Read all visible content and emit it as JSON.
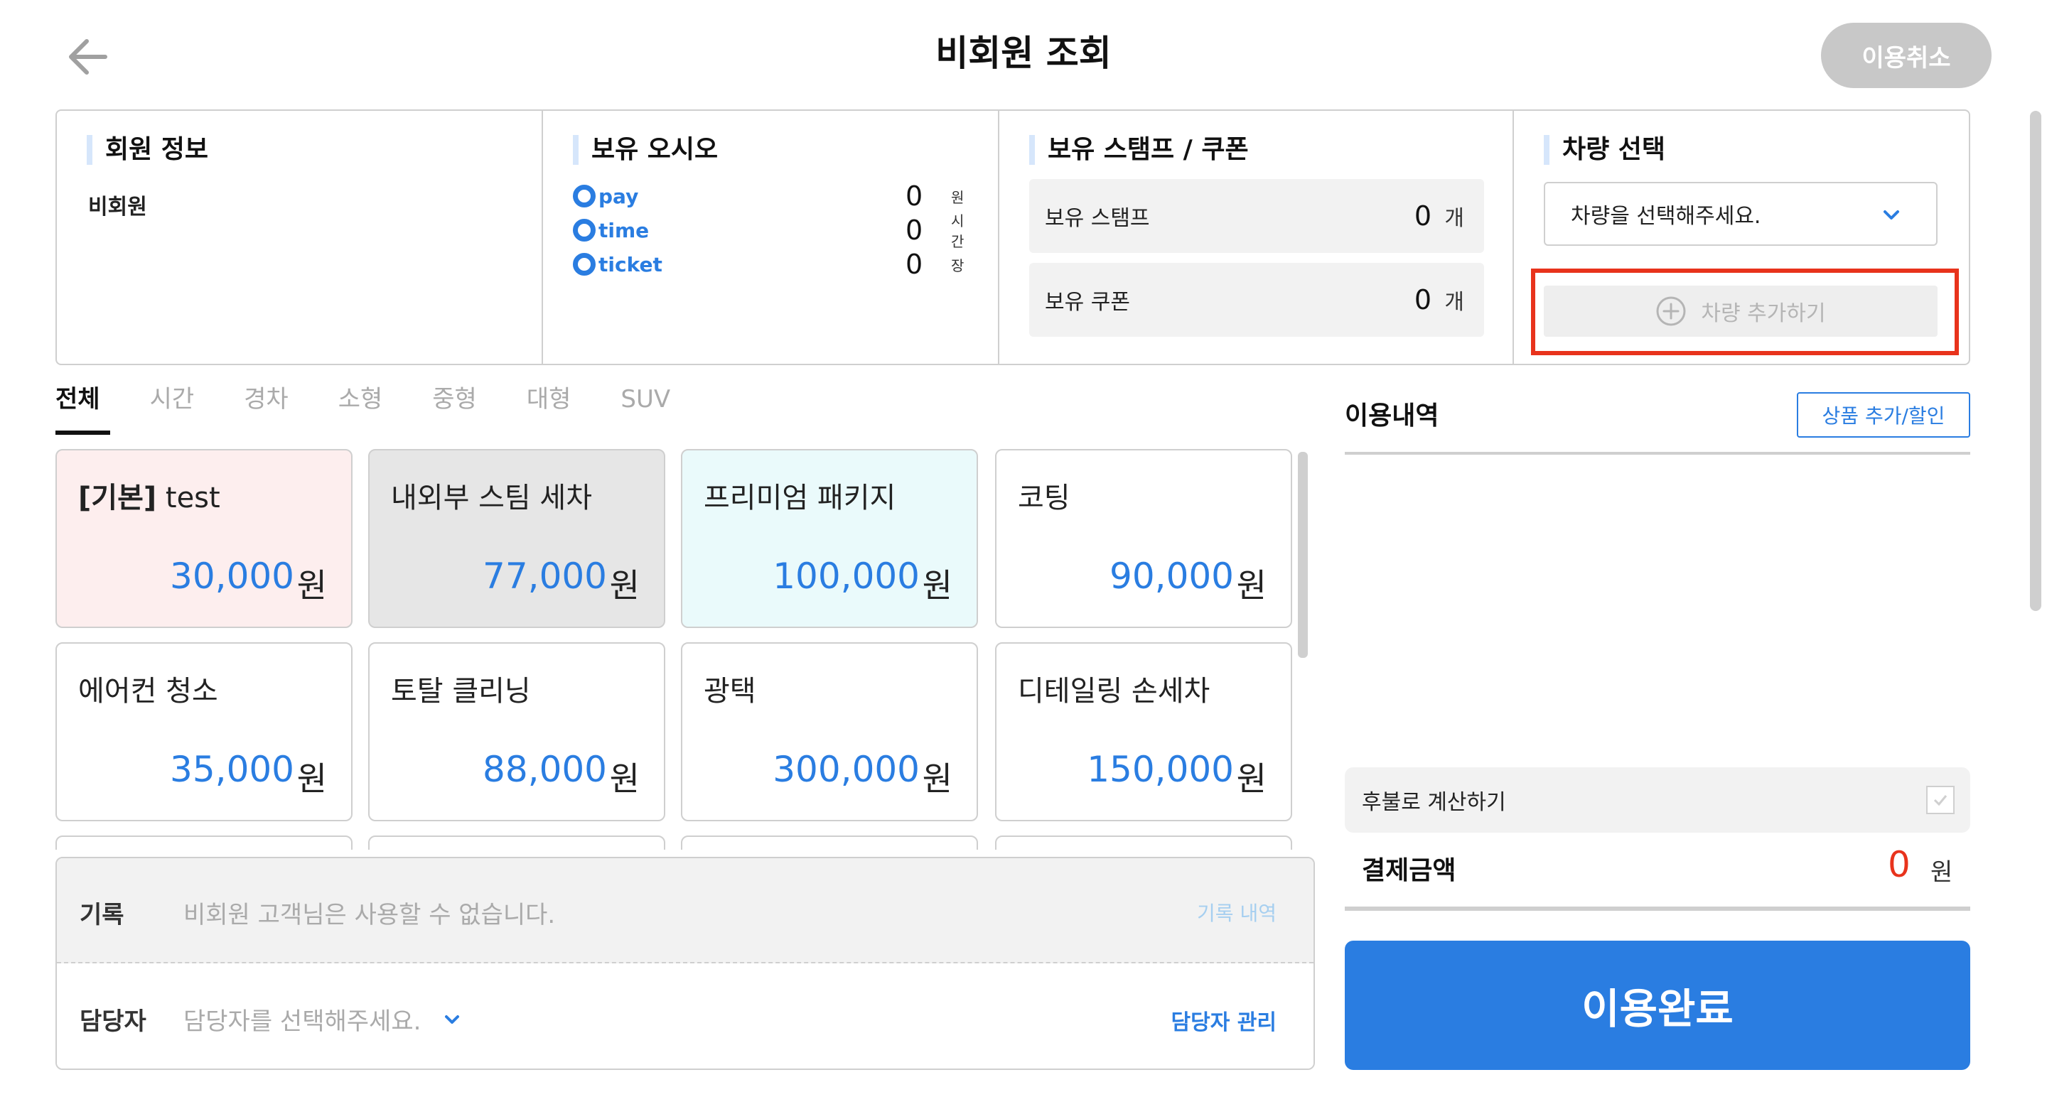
{
  "header": {
    "title": "비회원 조회",
    "cancel_label": "이용취소"
  },
  "member_info": {
    "title": "회원 정보",
    "type": "비회원"
  },
  "oasis": {
    "title": "보유 오시오",
    "items": [
      {
        "name": "pay",
        "value": "0",
        "unit": "원"
      },
      {
        "name": "time",
        "value": "0",
        "unit": "시간"
      },
      {
        "name": "ticket",
        "value": "0",
        "unit": "장"
      }
    ]
  },
  "stamp_coupon": {
    "title": "보유 스탬프 / 쿠폰",
    "stamp_label": "보유 스탬프",
    "stamp_value": "0",
    "stamp_unit": "개",
    "coupon_label": "보유 쿠폰",
    "coupon_value": "0",
    "coupon_unit": "개"
  },
  "car": {
    "title": "차량 선택",
    "select_placeholder": "차량을 선택해주세요.",
    "add_label": "차량 추가하기"
  },
  "tabs": [
    "전체",
    "시간",
    "경차",
    "소형",
    "중형",
    "대형",
    "SUV"
  ],
  "active_tab": "전체",
  "products": [
    {
      "prefix": "[기본]",
      "name": "test",
      "price": "30,000",
      "unit": "원",
      "bg": "#fdeeee"
    },
    {
      "prefix": "",
      "name": "내외부 스팀 세차",
      "price": "77,000",
      "unit": "원",
      "bg": "#e6e6e6"
    },
    {
      "prefix": "",
      "name": "프리미엄 패키지",
      "price": "100,000",
      "unit": "원",
      "bg": "#eafafb"
    },
    {
      "prefix": "",
      "name": "코팅",
      "price": "90,000",
      "unit": "원",
      "bg": "#ffffff"
    },
    {
      "prefix": "",
      "name": "에어컨 청소",
      "price": "35,000",
      "unit": "원",
      "bg": "#ffffff"
    },
    {
      "prefix": "",
      "name": "토탈 클리닝",
      "price": "88,000",
      "unit": "원",
      "bg": "#ffffff"
    },
    {
      "prefix": "",
      "name": "광택",
      "price": "300,000",
      "unit": "원",
      "bg": "#ffffff"
    },
    {
      "prefix": "",
      "name": "디테일링 손세차",
      "price": "150,000",
      "unit": "원",
      "bg": "#ffffff"
    }
  ],
  "record": {
    "label": "기록",
    "text": "비회원 고객님은 사용할 수 없습니다.",
    "link": "기록 내역"
  },
  "manager": {
    "label": "담당자",
    "placeholder": "담당자를 선택해주세요.",
    "link": "담당자 관리"
  },
  "usage": {
    "title": "이용내역",
    "add_discount": "상품 추가/할인",
    "postpay_label": "후불로 계산하기",
    "total_label": "결제금액",
    "total_value": "0",
    "total_unit": "원",
    "complete_label": "이용완료"
  },
  "colors": {
    "accent": "#2a7de1",
    "highlight": "#e8331c"
  }
}
